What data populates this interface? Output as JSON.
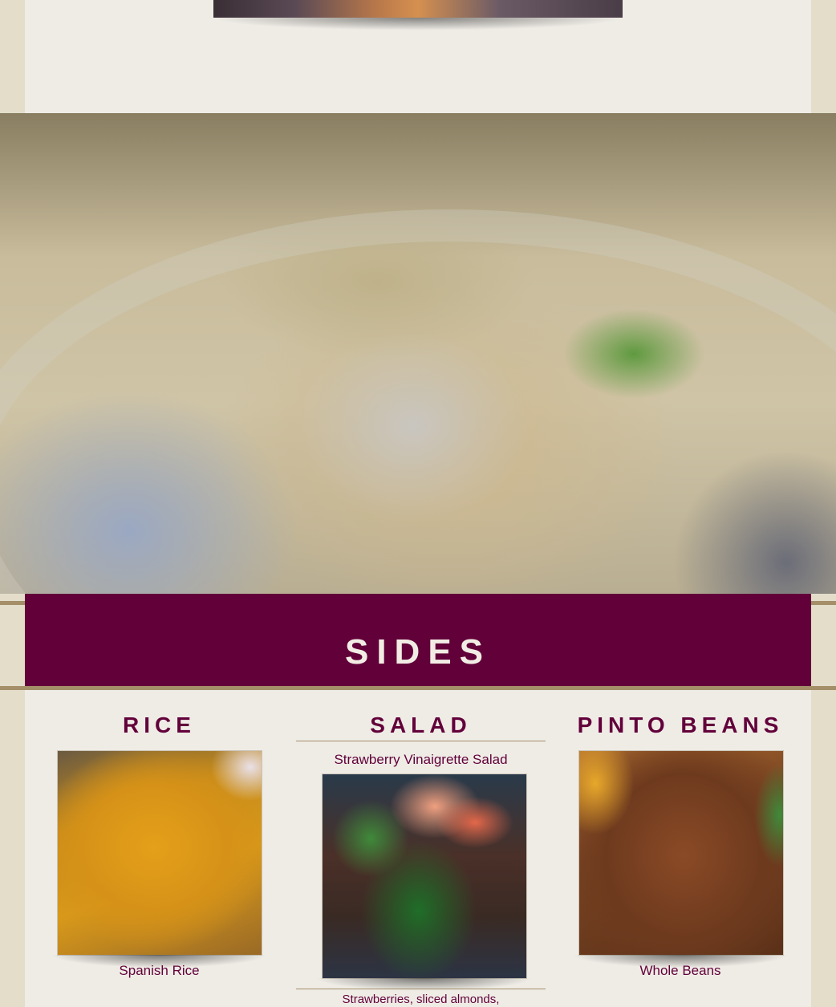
{
  "sections": {
    "sides_title": "SIDES"
  },
  "columns": [
    {
      "heading": "RICE",
      "caption": "Spanish Rice"
    },
    {
      "heading": "SALAD",
      "subtitle": "Strawberry Vinaigrette Salad",
      "description": "Strawberries, sliced almonds,"
    },
    {
      "heading": "PINTO BEANS",
      "caption": "Whole Beans"
    }
  ],
  "colors": {
    "accent": "#62003a",
    "gold": "#a48f69",
    "panel": "#efece6",
    "background": "#e3ddca"
  }
}
